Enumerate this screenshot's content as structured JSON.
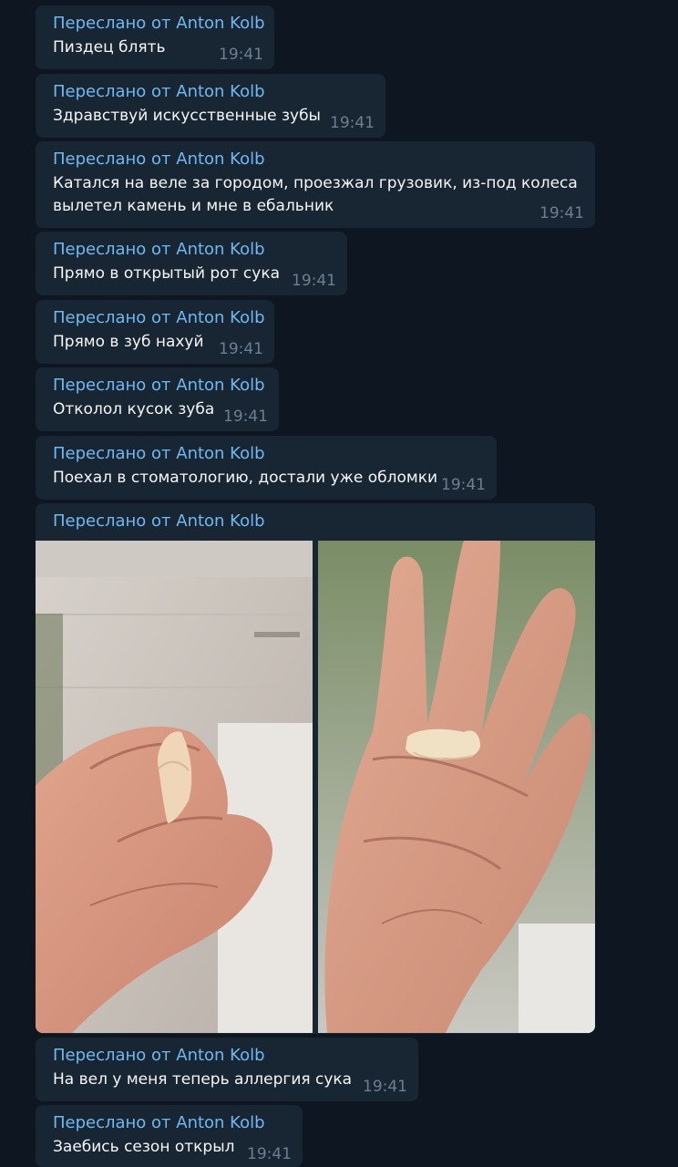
{
  "forward_label": "Переслано от Anton Kolb",
  "messages": [
    {
      "text": "Пиздец блять",
      "time": "19:41"
    },
    {
      "text": "Здравствуй искусственные зубы",
      "time": "19:41"
    },
    {
      "text": "Катался на веле за городом, проезжал грузовик, из-под колеса",
      "text2": "вылетел камень и мне в ебальник",
      "time": "19:41"
    },
    {
      "text": "Прямо в открытый рот сука",
      "time": "19:41"
    },
    {
      "text": "Прямо в зуб нахуй",
      "time": "19:41"
    },
    {
      "text": "Отколол кусок зуба",
      "time": "19:41"
    },
    {
      "text": "Поехал в стоматологию, достали уже обломки",
      "time": "19:41"
    },
    {
      "photos": [
        "tooth-fragment-on-fingertips",
        "tooth-on-palm"
      ]
    },
    {
      "text": "На вел у меня теперь аллергия сука",
      "time": "19:41"
    },
    {
      "text": "Заебись сезон открыл",
      "time": "19:41"
    }
  ],
  "colors": {
    "background": "#0e1621",
    "bubble": "#182533",
    "forward_name": "#71b8f0",
    "text": "#f5f5f5",
    "time": "#6d7f8f"
  }
}
